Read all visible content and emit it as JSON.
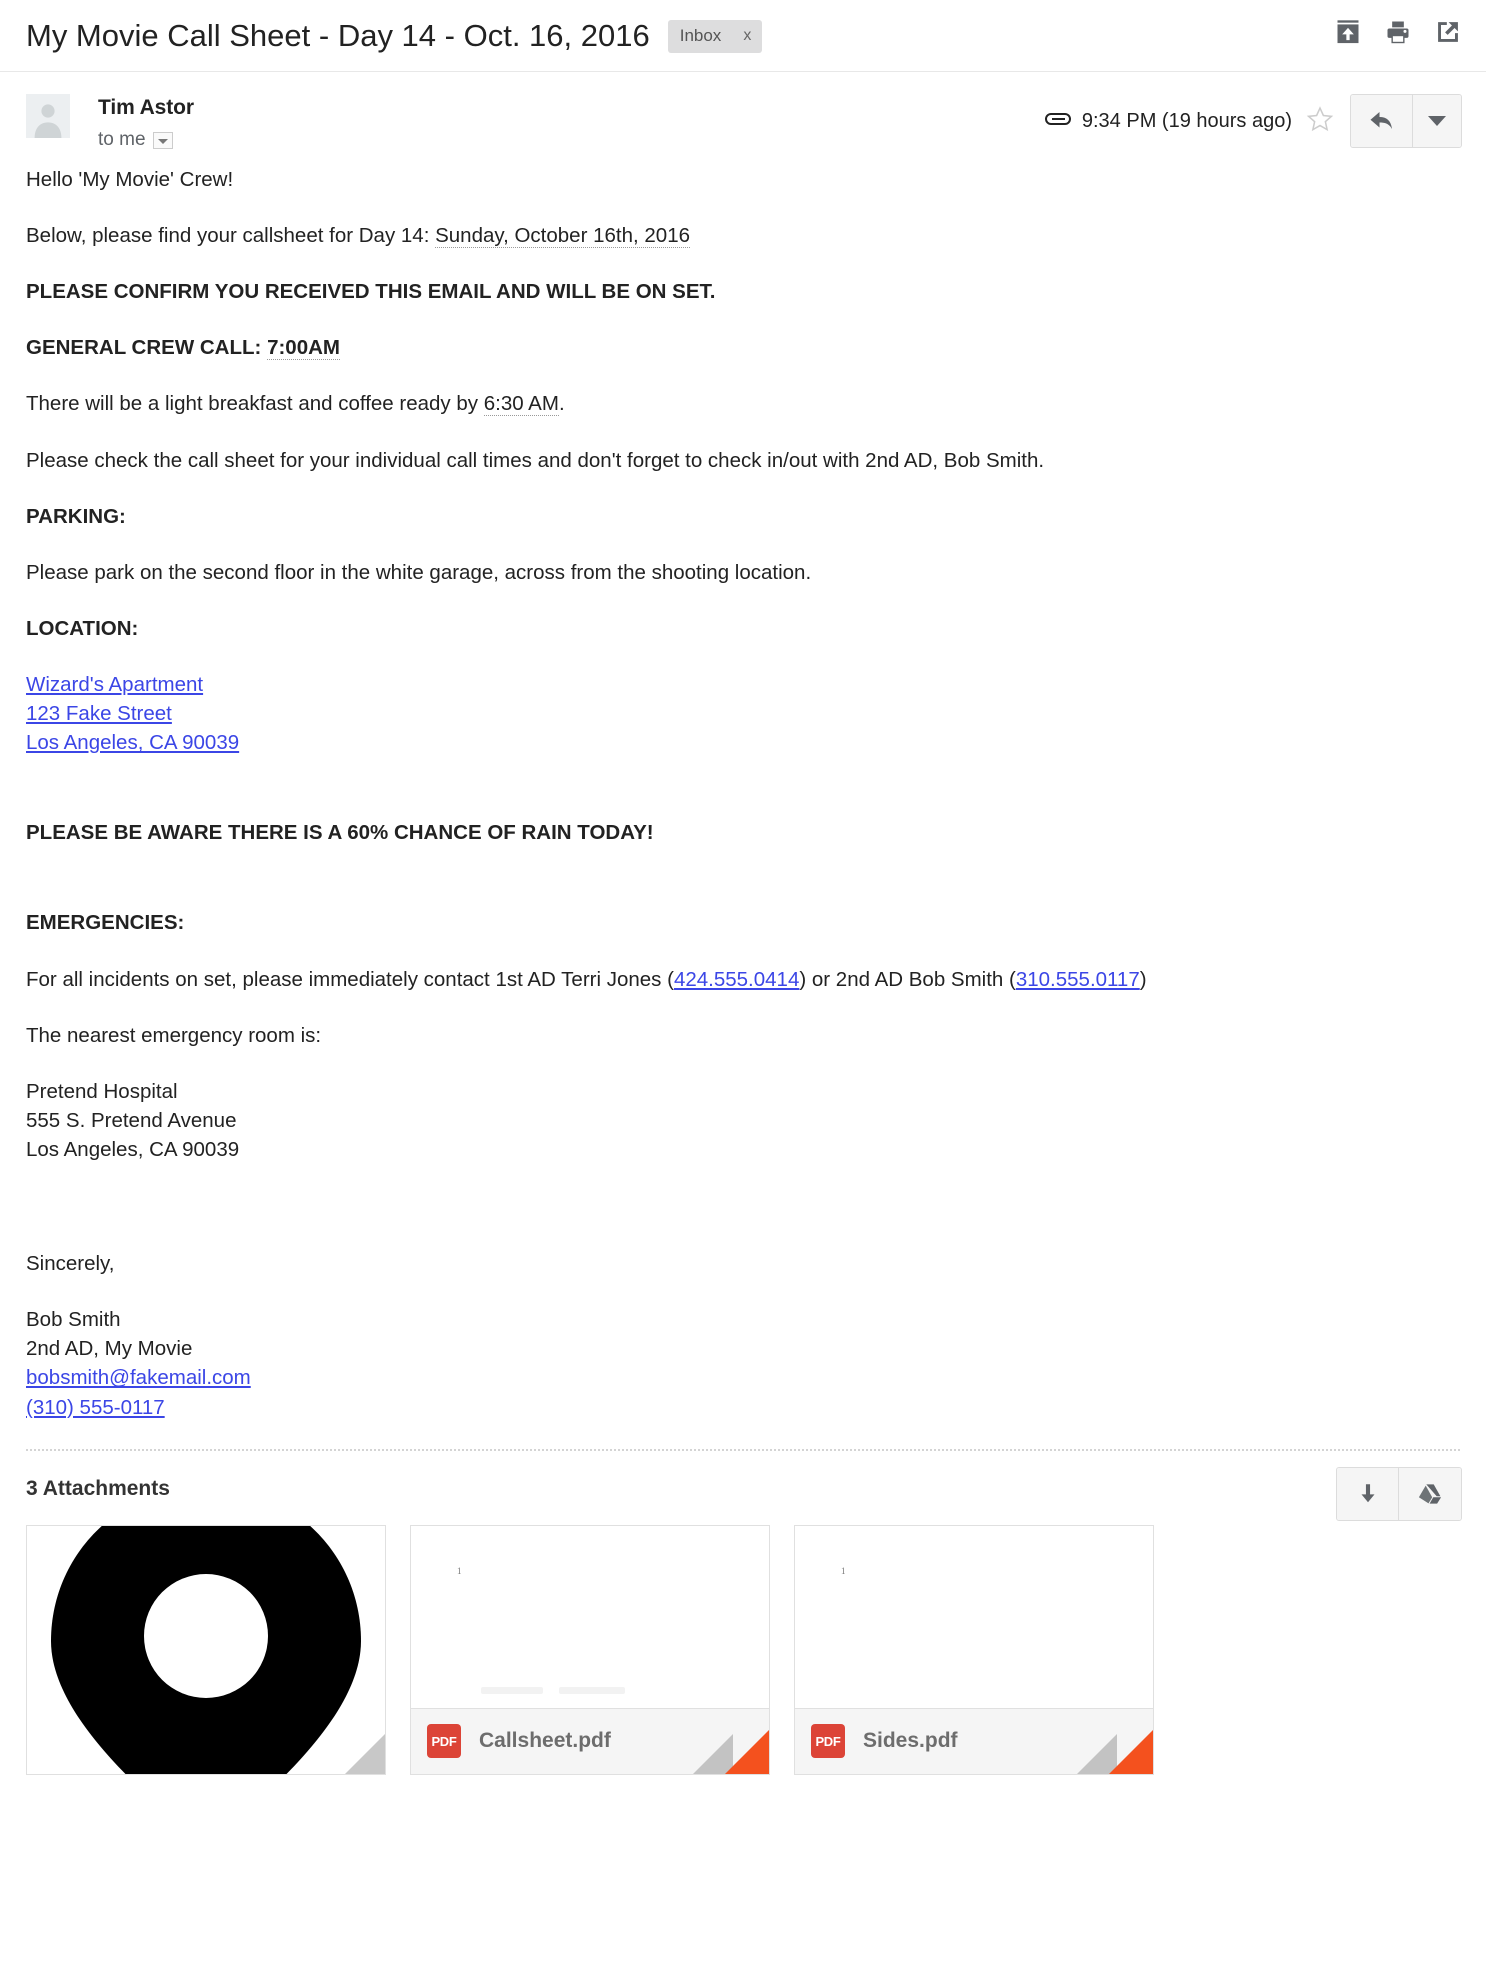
{
  "header": {
    "subject": "My Movie Call Sheet - Day 14 - Oct. 16, 2016",
    "label": "Inbox",
    "label_remove": "x",
    "actions": [
      {
        "name": "collapse-all-icon",
        "title": "Collapse all"
      },
      {
        "name": "print-icon",
        "title": "Print all"
      },
      {
        "name": "open-in-new-window-icon",
        "title": "Open in new window"
      }
    ]
  },
  "message": {
    "sender": "Tim Astor",
    "recipients": "to me",
    "timestamp": "9:34 PM (19 hours ago)",
    "has_attachment_icon": true,
    "star_label": "Not starred",
    "reply_label": "Reply",
    "more_label": "More"
  },
  "body": {
    "greeting": "Hello 'My Movie' Crew!",
    "intro_prefix": "Below, please find your callsheet for Day 14: ",
    "intro_date": "Sunday, October 16th, 2016",
    "confirm": "PLEASE CONFIRM YOU RECEIVED THIS EMAIL AND WILL BE ON SET.",
    "crew_call_label": "GENERAL CREW CALL: ",
    "crew_call_time": "7:00AM",
    "breakfast_prefix": "There will be a light breakfast and coffee ready by ",
    "breakfast_time": "6:30 AM",
    "breakfast_suffix": ".",
    "check_times": "Please check the call sheet for your individual call times and don't forget to check in/out with 2nd AD, Bob Smith.",
    "parking_heading": "PARKING:",
    "parking_text": "Please park on the second floor in the white garage, across from the shooting location.",
    "location_heading": "LOCATION:",
    "location_lines": [
      "Wizard's Apartment",
      "123 Fake Street",
      "Los Angeles, CA 90039"
    ],
    "rain_warning": "PLEASE BE AWARE THERE IS A 60% CHANCE OF RAIN TODAY!",
    "emergencies_heading": "EMERGENCIES:",
    "emergency_prefix": "For all incidents on set, please immediately contact 1st AD Terri Jones (",
    "emergency_phone_1": "424.555.0414",
    "emergency_middle": ") or 2nd AD Bob Smith (",
    "emergency_phone_2": "310.555.0117",
    "emergency_suffix": ")",
    "nearest_er": "The nearest emergency room is:",
    "hospital_lines": [
      "Pretend Hospital",
      "555 S. Pretend Avenue",
      "Los Angeles, CA 90039"
    ],
    "signoff": "Sincerely,",
    "signature_name": "Bob Smith",
    "signature_title": "2nd AD, My Movie",
    "signature_email": "bobsmith@fakemail.com",
    "signature_phone": "(310) 555-0117"
  },
  "attachments": {
    "title": "3 Attachments",
    "download_all_label": "Download all attachments",
    "save_to_drive_label": "Save all to Drive",
    "items": [
      {
        "filename": "",
        "type": "image",
        "preview": "map-pin",
        "has_bar": false,
        "page_label": ""
      },
      {
        "filename": "Callsheet.pdf",
        "type": "pdf",
        "preview": "document-page",
        "has_bar": true,
        "page_label": "1"
      },
      {
        "filename": "Sides.pdf",
        "type": "pdf",
        "preview": "document-page",
        "has_bar": true,
        "page_label": "1"
      }
    ],
    "pdf_badge_text": "PDF"
  },
  "colors": {
    "link": "#3b46e6",
    "warning_red": "#fc2100",
    "pdf_red": "#dc4437",
    "corner_orange": "#f4511e",
    "chip_bg": "#ddddde"
  }
}
